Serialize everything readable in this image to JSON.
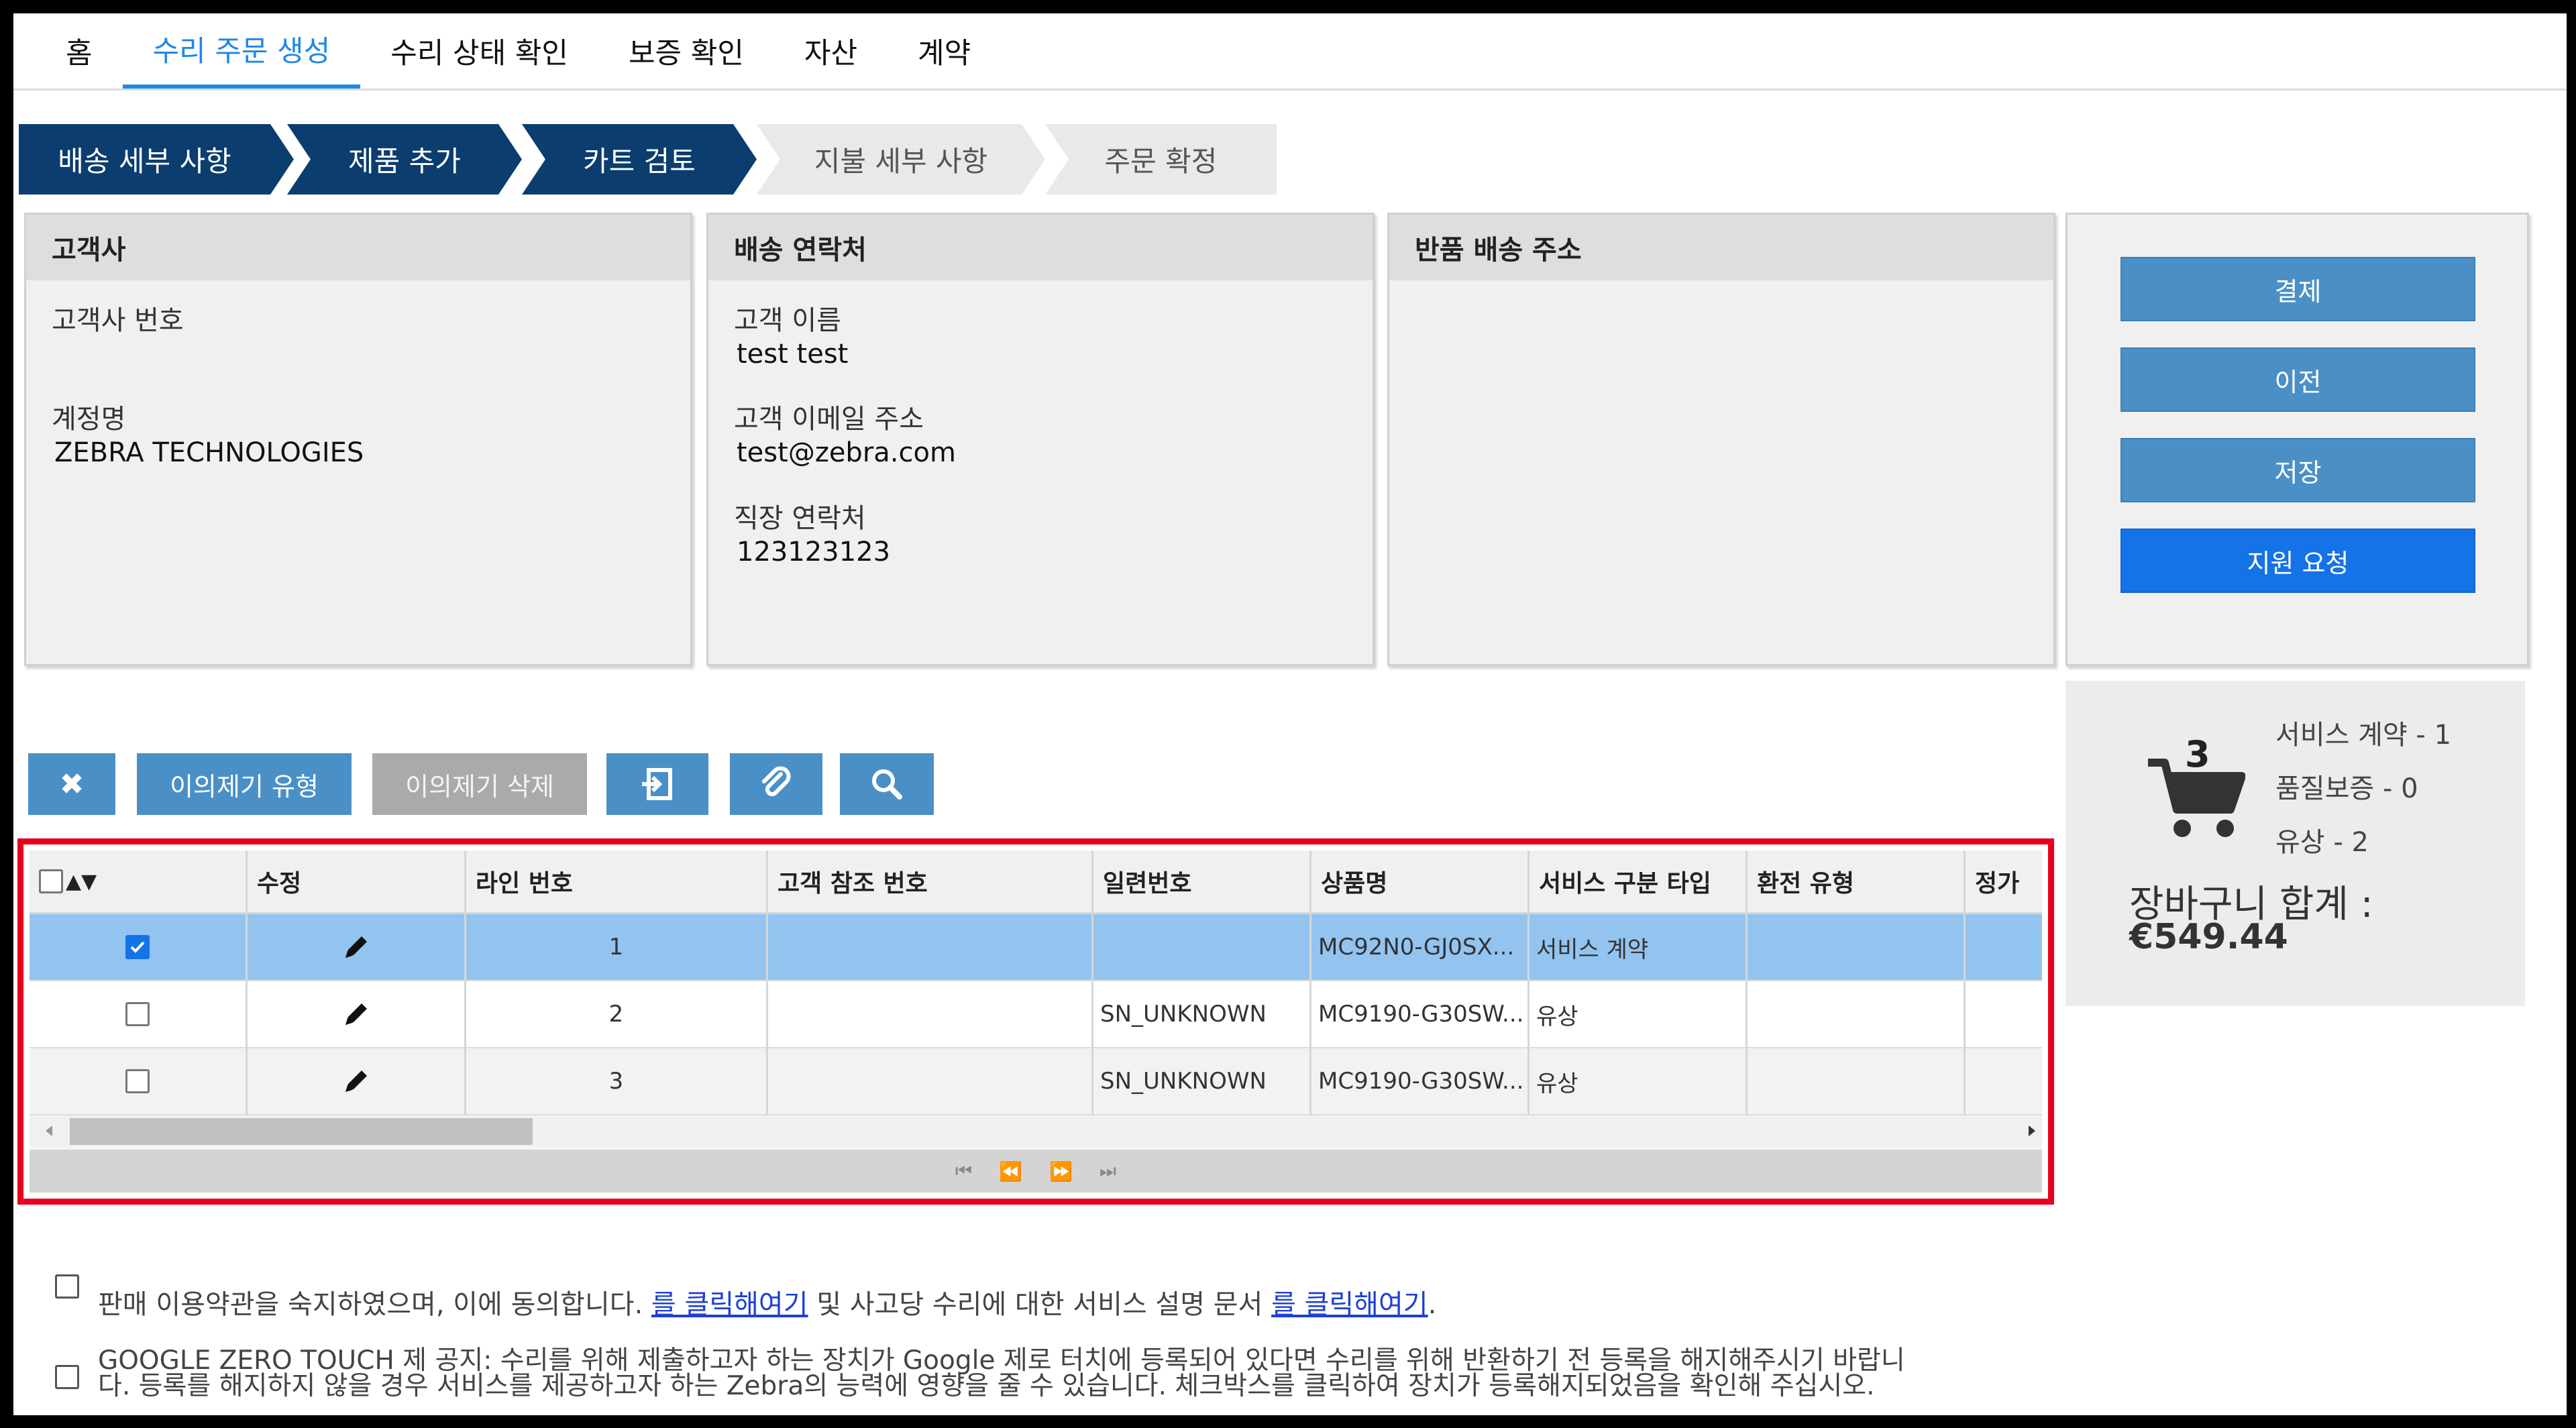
{
  "nav": {
    "items": [
      {
        "label": "홈",
        "active": false
      },
      {
        "label": "수리 주문 생성",
        "active": true
      },
      {
        "label": "수리 상태 확인",
        "active": false
      },
      {
        "label": "보증 확인",
        "active": false
      },
      {
        "label": "자산",
        "active": false
      },
      {
        "label": "계약",
        "active": false
      }
    ]
  },
  "stepper": {
    "steps": [
      {
        "label": "배송 세부 사항",
        "state": "done"
      },
      {
        "label": "제품 추가",
        "state": "done"
      },
      {
        "label": "카트 검토",
        "state": "done"
      },
      {
        "label": "지불 세부 사항",
        "state": "todo"
      },
      {
        "label": "주문 확정",
        "state": "todo"
      }
    ]
  },
  "customer": {
    "title": "고객사",
    "number_label": "고객사 번호",
    "number_value": "",
    "account_label": "계정명",
    "account_value": "ZEBRA TECHNOLOGIES"
  },
  "shipping_contact": {
    "title": "배송 연락처",
    "name_label": "고객 이름",
    "name_value": "test test",
    "email_label": "고객 이메일 주소",
    "email_value": "test@zebra.com",
    "phone_label": "직장 연락처",
    "phone_value": "123123123"
  },
  "return_address": {
    "title": "반품 배송 주소"
  },
  "actions": {
    "pay": "결제",
    "prev": "이전",
    "save": "저장",
    "support": "지원 요청"
  },
  "cart": {
    "count": "3",
    "lines": [
      "서비스 계약 - 1",
      "품질보증 - 0",
      "유상 - 2"
    ],
    "total_label": "장바구니 합계 :",
    "total_value": "€549.44"
  },
  "toolbar": {
    "delete_icon": "✖",
    "complaint_type": "이의제기 유형",
    "complaint_delete": "이의제기 삭제",
    "export_icon": "export-icon",
    "attach_icon": "paperclip-icon",
    "search_icon": "search-icon"
  },
  "grid": {
    "sort_indicator": "▲▼",
    "columns": [
      "수정",
      "라인 번호",
      "고객 참조 번호",
      "일련번호",
      "상품명",
      "서비스 구분 타입",
      "환전 유형",
      "정가"
    ],
    "rows": [
      {
        "checked": true,
        "line": "1",
        "ref": "",
        "serial": "",
        "product": "MC92N0-GJ0SX...",
        "service": "서비스 계약",
        "exchange": "",
        "price": ""
      },
      {
        "checked": false,
        "line": "2",
        "ref": "",
        "serial": "SN_UNKNOWN",
        "product": "MC9190-G30SW...",
        "service": "유상",
        "exchange": "",
        "price": ""
      },
      {
        "checked": false,
        "line": "3",
        "ref": "",
        "serial": "SN_UNKNOWN",
        "product": "MC9190-G30SW...",
        "service": "유상",
        "exchange": "",
        "price": ""
      }
    ],
    "pager": [
      "⏮",
      "⏪",
      "⏩",
      "⏭"
    ]
  },
  "terms": {
    "t1_a": "판매 이용약관을 숙지하였으며, 이에 동의합니다. ",
    "t1_link1": "를 클릭해여기",
    "t1_b": " 및 사고당 수리에 대한 서비스 설명 문서 ",
    "t1_link2": "를 클릭해여기",
    "t1_c": ".",
    "t2_line1": "GOOGLE ZERO TOUCH 제 공지: 수리를 위해 제출하고자 하는 장치가 Google 제로 터치에 등록되어 있다면 수리를 위해 반환하기 전 등록을 해지해주시기 바랍니",
    "t2_line2": "다. 등록를 해지하지 않을 경우 서비스를 제공하고자 하는 Zebra의 능력에 영향을 줄 수 있습니다. 체크박스를 클릭하여 장치가 등록해지되었음을 확인해 주십시오."
  },
  "colors": {
    "accent": "#1e88e5",
    "step_done": "#0b3d6e",
    "button": "#4a90c6",
    "primary": "#1473e6",
    "highlight": "#e8001c",
    "selected_row": "#93c4f0"
  }
}
